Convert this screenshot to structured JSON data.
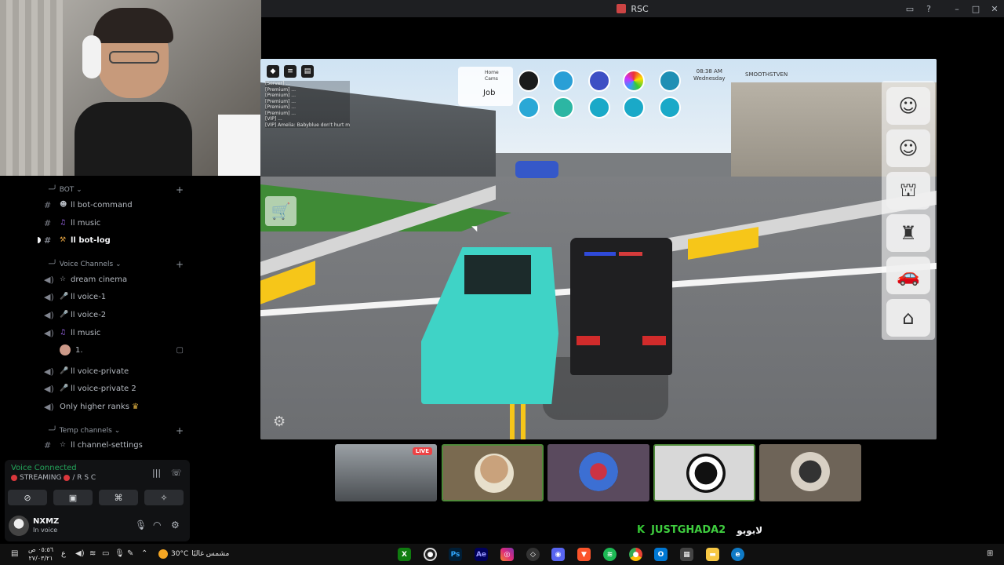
{
  "window": {
    "title": "RSC"
  },
  "sidebar": {
    "categories": [
      {
        "label": "BOT"
      },
      {
        "label": "Voice Channels"
      },
      {
        "label": "Temp channels"
      }
    ],
    "channels": [
      {
        "name": "ll bot-command",
        "type": "text"
      },
      {
        "name": "ll music",
        "type": "text"
      },
      {
        "name": "ll bot-log",
        "type": "text",
        "active": true
      },
      {
        "name": "dream cinema",
        "type": "voice"
      },
      {
        "name": "ll voice-1",
        "type": "voice"
      },
      {
        "name": "ll voice-2",
        "type": "voice"
      },
      {
        "name": "ll music",
        "type": "voice"
      },
      {
        "name": "1.",
        "type": "member"
      },
      {
        "name": "ll voice-private",
        "type": "voice"
      },
      {
        "name": "ll voice-private 2",
        "type": "voice"
      },
      {
        "name": "Only higher ranks",
        "type": "voice"
      },
      {
        "name": "ll channel-settings",
        "type": "text"
      }
    ]
  },
  "voice_panel": {
    "status": "Voice Connected",
    "streaming_label": "STREAMING",
    "server": "/ R S C"
  },
  "user_panel": {
    "username": "NXMZ",
    "status": "In voice"
  },
  "game": {
    "hud": {
      "home_label": "Home",
      "cams_label": "Cams",
      "job_label": "Job",
      "clock_time": "08:38 AM",
      "clock_day": "Wednesday",
      "player_tag": "SMOOTHSTVEN"
    },
    "chat_lines": [
      "[Server] ...",
      "[Premium] ...",
      "[Premium] ...",
      "[Premium] ...",
      "[Premium] ...",
      "[Premium] ...",
      "[VIP] ...",
      "[VIP] Amelia: Babyblue don't hurt me"
    ]
  },
  "streams": [
    {
      "live": "LIVE"
    },
    {},
    {},
    {},
    {}
  ],
  "gift": {
    "icon": "K",
    "name": "JUSTGHADA2",
    "message": "لابوبو"
  },
  "taskbar": {
    "time": "٠٥:٥٦ ص",
    "date": "٢٧/٠٣/٢١",
    "weather_temp": "30°C",
    "weather_desc": "مشمس غالبًا",
    "apps": [
      "xbox",
      "obs",
      "Ps",
      "Ae",
      "instagram",
      "roblox",
      "discord",
      "brave",
      "spotify",
      "chrome",
      "outlook",
      "calculator",
      "explorer",
      "edge"
    ]
  },
  "colors": {
    "accent_green": "#23a55a",
    "live_red": "#ed4245",
    "discord_bg": "#111214"
  }
}
